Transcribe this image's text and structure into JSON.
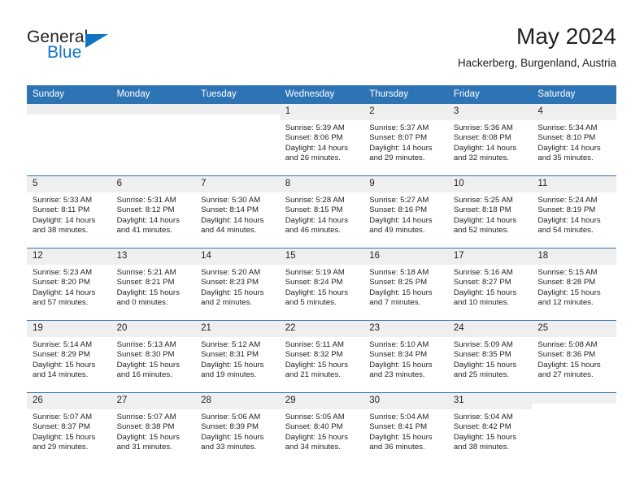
{
  "brand": {
    "name_part1": "General",
    "name_part2": "Blue"
  },
  "header": {
    "title": "May 2024",
    "location": "Hackerberg, Burgenland, Austria"
  },
  "colors": {
    "header_blue": "#2e74b5",
    "brand_blue": "#1272c4",
    "daybar_gray": "#efefef",
    "text": "#231f20"
  },
  "weekday_headers": [
    "Sunday",
    "Monday",
    "Tuesday",
    "Wednesday",
    "Thursday",
    "Friday",
    "Saturday"
  ],
  "weeks": [
    [
      {
        "day": "",
        "empty": true
      },
      {
        "day": "",
        "empty": true
      },
      {
        "day": "",
        "empty": true
      },
      {
        "day": "1",
        "sunrise": "Sunrise: 5:39 AM",
        "sunset": "Sunset: 8:06 PM",
        "daylight": "Daylight: 14 hours and 26 minutes."
      },
      {
        "day": "2",
        "sunrise": "Sunrise: 5:37 AM",
        "sunset": "Sunset: 8:07 PM",
        "daylight": "Daylight: 14 hours and 29 minutes."
      },
      {
        "day": "3",
        "sunrise": "Sunrise: 5:36 AM",
        "sunset": "Sunset: 8:08 PM",
        "daylight": "Daylight: 14 hours and 32 minutes."
      },
      {
        "day": "4",
        "sunrise": "Sunrise: 5:34 AM",
        "sunset": "Sunset: 8:10 PM",
        "daylight": "Daylight: 14 hours and 35 minutes."
      }
    ],
    [
      {
        "day": "5",
        "sunrise": "Sunrise: 5:33 AM",
        "sunset": "Sunset: 8:11 PM",
        "daylight": "Daylight: 14 hours and 38 minutes."
      },
      {
        "day": "6",
        "sunrise": "Sunrise: 5:31 AM",
        "sunset": "Sunset: 8:12 PM",
        "daylight": "Daylight: 14 hours and 41 minutes."
      },
      {
        "day": "7",
        "sunrise": "Sunrise: 5:30 AM",
        "sunset": "Sunset: 8:14 PM",
        "daylight": "Daylight: 14 hours and 44 minutes."
      },
      {
        "day": "8",
        "sunrise": "Sunrise: 5:28 AM",
        "sunset": "Sunset: 8:15 PM",
        "daylight": "Daylight: 14 hours and 46 minutes."
      },
      {
        "day": "9",
        "sunrise": "Sunrise: 5:27 AM",
        "sunset": "Sunset: 8:16 PM",
        "daylight": "Daylight: 14 hours and 49 minutes."
      },
      {
        "day": "10",
        "sunrise": "Sunrise: 5:25 AM",
        "sunset": "Sunset: 8:18 PM",
        "daylight": "Daylight: 14 hours and 52 minutes."
      },
      {
        "day": "11",
        "sunrise": "Sunrise: 5:24 AM",
        "sunset": "Sunset: 8:19 PM",
        "daylight": "Daylight: 14 hours and 54 minutes."
      }
    ],
    [
      {
        "day": "12",
        "sunrise": "Sunrise: 5:23 AM",
        "sunset": "Sunset: 8:20 PM",
        "daylight": "Daylight: 14 hours and 57 minutes."
      },
      {
        "day": "13",
        "sunrise": "Sunrise: 5:21 AM",
        "sunset": "Sunset: 8:21 PM",
        "daylight": "Daylight: 15 hours and 0 minutes."
      },
      {
        "day": "14",
        "sunrise": "Sunrise: 5:20 AM",
        "sunset": "Sunset: 8:23 PM",
        "daylight": "Daylight: 15 hours and 2 minutes."
      },
      {
        "day": "15",
        "sunrise": "Sunrise: 5:19 AM",
        "sunset": "Sunset: 8:24 PM",
        "daylight": "Daylight: 15 hours and 5 minutes."
      },
      {
        "day": "16",
        "sunrise": "Sunrise: 5:18 AM",
        "sunset": "Sunset: 8:25 PM",
        "daylight": "Daylight: 15 hours and 7 minutes."
      },
      {
        "day": "17",
        "sunrise": "Sunrise: 5:16 AM",
        "sunset": "Sunset: 8:27 PM",
        "daylight": "Daylight: 15 hours and 10 minutes."
      },
      {
        "day": "18",
        "sunrise": "Sunrise: 5:15 AM",
        "sunset": "Sunset: 8:28 PM",
        "daylight": "Daylight: 15 hours and 12 minutes."
      }
    ],
    [
      {
        "day": "19",
        "sunrise": "Sunrise: 5:14 AM",
        "sunset": "Sunset: 8:29 PM",
        "daylight": "Daylight: 15 hours and 14 minutes."
      },
      {
        "day": "20",
        "sunrise": "Sunrise: 5:13 AM",
        "sunset": "Sunset: 8:30 PM",
        "daylight": "Daylight: 15 hours and 16 minutes."
      },
      {
        "day": "21",
        "sunrise": "Sunrise: 5:12 AM",
        "sunset": "Sunset: 8:31 PM",
        "daylight": "Daylight: 15 hours and 19 minutes."
      },
      {
        "day": "22",
        "sunrise": "Sunrise: 5:11 AM",
        "sunset": "Sunset: 8:32 PM",
        "daylight": "Daylight: 15 hours and 21 minutes."
      },
      {
        "day": "23",
        "sunrise": "Sunrise: 5:10 AM",
        "sunset": "Sunset: 8:34 PM",
        "daylight": "Daylight: 15 hours and 23 minutes."
      },
      {
        "day": "24",
        "sunrise": "Sunrise: 5:09 AM",
        "sunset": "Sunset: 8:35 PM",
        "daylight": "Daylight: 15 hours and 25 minutes."
      },
      {
        "day": "25",
        "sunrise": "Sunrise: 5:08 AM",
        "sunset": "Sunset: 8:36 PM",
        "daylight": "Daylight: 15 hours and 27 minutes."
      }
    ],
    [
      {
        "day": "26",
        "sunrise": "Sunrise: 5:07 AM",
        "sunset": "Sunset: 8:37 PM",
        "daylight": "Daylight: 15 hours and 29 minutes."
      },
      {
        "day": "27",
        "sunrise": "Sunrise: 5:07 AM",
        "sunset": "Sunset: 8:38 PM",
        "daylight": "Daylight: 15 hours and 31 minutes."
      },
      {
        "day": "28",
        "sunrise": "Sunrise: 5:06 AM",
        "sunset": "Sunset: 8:39 PM",
        "daylight": "Daylight: 15 hours and 33 minutes."
      },
      {
        "day": "29",
        "sunrise": "Sunrise: 5:05 AM",
        "sunset": "Sunset: 8:40 PM",
        "daylight": "Daylight: 15 hours and 34 minutes."
      },
      {
        "day": "30",
        "sunrise": "Sunrise: 5:04 AM",
        "sunset": "Sunset: 8:41 PM",
        "daylight": "Daylight: 15 hours and 36 minutes."
      },
      {
        "day": "31",
        "sunrise": "Sunrise: 5:04 AM",
        "sunset": "Sunset: 8:42 PM",
        "daylight": "Daylight: 15 hours and 38 minutes."
      },
      {
        "day": "",
        "empty": true
      }
    ]
  ]
}
